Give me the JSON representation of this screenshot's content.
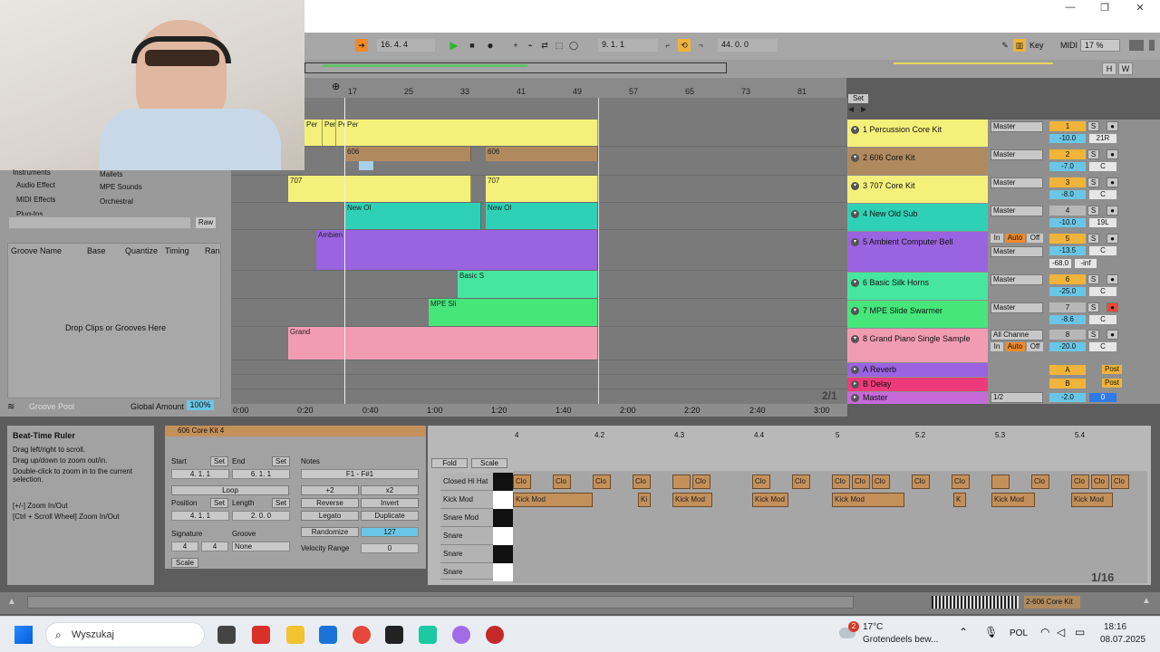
{
  "window": {
    "controls": [
      "—",
      "❐",
      "✕"
    ]
  },
  "transport": {
    "arrangement_position": "16. 4. 4",
    "loop_start": "9. 1. 1",
    "loop_length": "44. 0. 0",
    "key_label": "Key",
    "midi_label": "MIDI",
    "cpu": "17 %",
    "h_label": "H",
    "w_label": "W"
  },
  "ruler": {
    "bars": [
      "17",
      "25",
      "33",
      "41",
      "49",
      "57",
      "65",
      "73",
      "81"
    ],
    "set_label": "Set"
  },
  "time_ruler": [
    "0:00",
    "0:20",
    "0:40",
    "1:00",
    "1:20",
    "1:40",
    "2:00",
    "2:20",
    "2:40",
    "3:00"
  ],
  "zoom_indicator": "2/1",
  "browser": {
    "items_left": [
      "Instruments",
      "Audio Effect",
      "MIDI Effects",
      "Plug-Ins"
    ],
    "items_right": [
      "Mallets",
      "MPE Sounds",
      "Orchestral"
    ],
    "raw_label": "Raw"
  },
  "groove_pool": {
    "headers": [
      "Groove Name",
      "Base",
      "Quantize",
      "Timing",
      "Ran"
    ],
    "empty_text": "Drop Clips or Grooves Here",
    "footer_label": "Groove Pool",
    "global_amount_label": "Global Amount",
    "global_amount_value": "100%"
  },
  "tracks": [
    {
      "num": "1",
      "name": "1 Percussion Core Kit",
      "color": "#f5f07a",
      "clip_label": "Per",
      "output": "Master",
      "volume": "-10.0",
      "pan": "21R"
    },
    {
      "num": "2",
      "name": "2 606 Core Kit",
      "color": "#b08a5f",
      "clip_label": "606",
      "output": "Master",
      "volume": "-7.0",
      "pan": "C"
    },
    {
      "num": "3",
      "name": "3 707 Core Kit",
      "color": "#f5f07a",
      "clip_label": "707",
      "output": "Master",
      "volume": "-8.0",
      "pan": "C"
    },
    {
      "num": "4",
      "name": "4 New Old Sub",
      "color": "#2fd1b6",
      "clip_label": "New Ol",
      "output": "Master",
      "volume": "-10.0",
      "pan": "19L"
    },
    {
      "num": "5",
      "name": "5 Ambient Computer Bell",
      "color": "#9a63e0",
      "clip_label": "Ambien",
      "output": "Master",
      "volume": "-13.5",
      "pan": "C",
      "sends": [
        "-68.0",
        "-inf"
      ],
      "in_label": "In",
      "auto_label": "Auto",
      "off_label": "Off"
    },
    {
      "num": "6",
      "name": "6 Basic Silk Horns",
      "color": "#46e6a0",
      "clip_label": "Basic S",
      "output": "Master",
      "volume": "-25.0",
      "pan": "C"
    },
    {
      "num": "7",
      "name": "7 MPE Slide Swarmer",
      "color": "#46e67a",
      "clip_label": "MPE Sli",
      "output": "Master",
      "volume": "-8.6",
      "pan": "C"
    },
    {
      "num": "8",
      "name": "8 Grand Piano Single Sample",
      "color": "#f29cb4",
      "clip_label": "Grand",
      "output": "All Channe",
      "volume": "-20.0",
      "pan": "C",
      "in_label": "In",
      "auto_label": "Auto",
      "off_label": "Off"
    }
  ],
  "returns": [
    {
      "letter": "A",
      "name": "A Reverb",
      "color": "#9a63e0",
      "post": "Post"
    },
    {
      "letter": "B",
      "name": "B Delay",
      "color": "#ee3a7a",
      "post": "Post"
    }
  ],
  "master": {
    "name": "Master",
    "color": "#c66ad9",
    "output": "1/2",
    "volume": "-2.0",
    "pan": "0"
  },
  "info_view": {
    "title": "Beat-Time Ruler",
    "lines": [
      "Drag left/right to scroll.",
      "Drag up/down to zoom out/in.",
      "Double-click to zoom in to the current selection.",
      "",
      "[+/-] Zoom In/Out",
      "[Ctrl + Scroll Wheel] Zoom In/Out"
    ]
  },
  "clip_view": {
    "clip_name": "606 Core Kit 4",
    "start_label": "Start",
    "set_label": "Set",
    "end_label": "End",
    "start": "4. 1. 1",
    "end": "6. 1. 1",
    "loop_label": "Loop",
    "position_label": "Position",
    "length_label": "Length",
    "position": "4. 1. 1",
    "length": "2. 0. 0",
    "signature_label": "Signature",
    "groove_label": "Groove",
    "sig_num": "4",
    "sig_den": "4",
    "groove_value": "None",
    "scale_label": "Scale",
    "notes_label": "Notes",
    "note_range": "F1 - F#1",
    "plus2": "+2",
    "times2": "x2",
    "reverse": "Reverse",
    "invert": "Invert",
    "legato": "Legato",
    "duplicate": "Duplicate",
    "randomize": "Randomize",
    "randomize_value": "127",
    "velocity_range_label": "Velocity Range",
    "velocity_range_value": "0"
  },
  "midi_editor": {
    "fold_label": "Fold",
    "scale_label": "Scale",
    "bars": [
      "4",
      "4.2",
      "4.3",
      "4.4",
      "5",
      "5.2",
      "5.3",
      "5.4"
    ],
    "rows": [
      "Closed Hi Hat",
      "Kick Mod",
      "Snare Mod",
      "Snare",
      "Snare",
      "Snare"
    ],
    "hat_label": "Clo",
    "kick_label": "Kick Mod",
    "kick_short": "Ki",
    "kick_k": "K",
    "grid": "1/16"
  },
  "status": {
    "track_label": "2-606 Core Kit"
  },
  "taskbar": {
    "search": "Wyszukaj",
    "weather_temp": "17°C",
    "weather_desc": "Grotendeels bew...",
    "weather_badge": "2",
    "lang": "POL",
    "time": "18:16",
    "date": "08.07.2025"
  }
}
